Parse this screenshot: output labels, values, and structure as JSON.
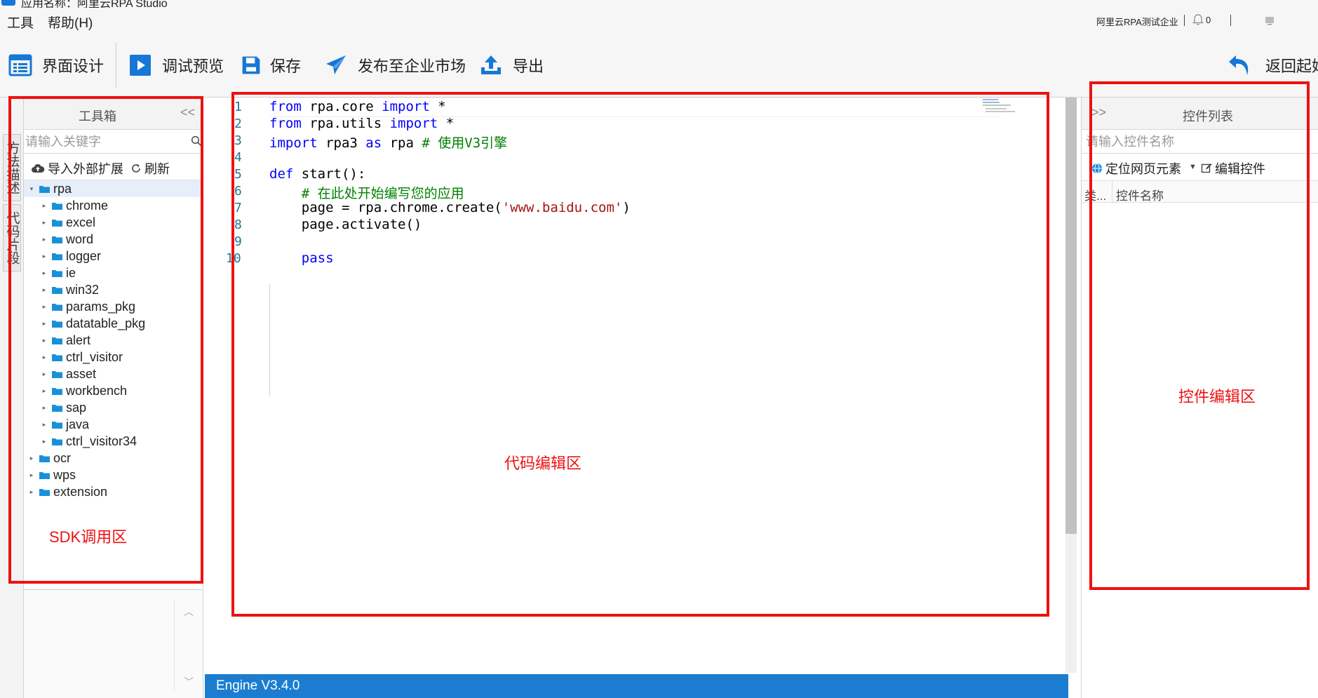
{
  "window": {
    "title": "应用名称：阿里云RPA Studio"
  },
  "menu": {
    "tools": "工具",
    "help": "帮助(H)"
  },
  "topbar": {
    "org_name": "阿里云RPA测试企业",
    "notification_count": "0"
  },
  "toolbar": {
    "ui_design": "界面设计",
    "debug_preview": "调试预览",
    "save": "保存",
    "publish": "发布至企业市场",
    "export": "导出",
    "back": "返回起始"
  },
  "side_tabs": {
    "method_desc": "方法描述",
    "code_snippet": "代码片段"
  },
  "toolbox": {
    "title": "工具箱",
    "collapse": "<<",
    "search_placeholder": "请输入关键字",
    "import_ext": "导入外部扩展",
    "refresh": "刷新",
    "tree": [
      {
        "label": "rpa",
        "level": 0,
        "expanded": true,
        "selected": true
      },
      {
        "label": "chrome",
        "level": 1
      },
      {
        "label": "excel",
        "level": 1
      },
      {
        "label": "word",
        "level": 1
      },
      {
        "label": "logger",
        "level": 1
      },
      {
        "label": "ie",
        "level": 1
      },
      {
        "label": "win32",
        "level": 1
      },
      {
        "label": "params_pkg",
        "level": 1
      },
      {
        "label": "datatable_pkg",
        "level": 1
      },
      {
        "label": "alert",
        "level": 1
      },
      {
        "label": "ctrl_visitor",
        "level": 1
      },
      {
        "label": "asset",
        "level": 1
      },
      {
        "label": "workbench",
        "level": 1
      },
      {
        "label": "sap",
        "level": 1
      },
      {
        "label": "java",
        "level": 1
      },
      {
        "label": "ctrl_visitor34",
        "level": 1
      },
      {
        "label": "ocr",
        "level": 0
      },
      {
        "label": "wps",
        "level": 0
      },
      {
        "label": "extension",
        "level": 0
      }
    ]
  },
  "editor": {
    "line_numbers": [
      "1",
      "2",
      "3",
      "4",
      "5",
      "6",
      "7",
      "8",
      "9",
      "10"
    ],
    "code_lines": [
      [
        {
          "t": "kw",
          "v": "from"
        },
        {
          "t": "p",
          "v": " rpa.core "
        },
        {
          "t": "kw",
          "v": "import"
        },
        {
          "t": "p",
          "v": " *"
        }
      ],
      [
        {
          "t": "kw",
          "v": "from"
        },
        {
          "t": "p",
          "v": " rpa.utils "
        },
        {
          "t": "kw",
          "v": "import"
        },
        {
          "t": "p",
          "v": " *"
        }
      ],
      [
        {
          "t": "kw",
          "v": "import"
        },
        {
          "t": "p",
          "v": " rpa3 "
        },
        {
          "t": "kw",
          "v": "as"
        },
        {
          "t": "p",
          "v": " rpa "
        },
        {
          "t": "cmt",
          "v": "# 使用V3引擎"
        }
      ],
      [],
      [
        {
          "t": "kw",
          "v": "def"
        },
        {
          "t": "p",
          "v": " start():"
        }
      ],
      [
        {
          "t": "p",
          "v": "    "
        },
        {
          "t": "cmt",
          "v": "# 在此处开始编写您的应用"
        }
      ],
      [
        {
          "t": "p",
          "v": "    page = rpa.chrome.create("
        },
        {
          "t": "str",
          "v": "'www.baidu.com'"
        },
        {
          "t": "p",
          "v": ")"
        }
      ],
      [
        {
          "t": "p",
          "v": "    page.activate()"
        }
      ],
      [],
      [
        {
          "t": "p",
          "v": "    "
        },
        {
          "t": "kw",
          "v": "pass"
        }
      ]
    ],
    "status": "Engine V3.4.0"
  },
  "controls_panel": {
    "expand": ">>",
    "title": "控件列表",
    "search_placeholder": "请输入控件名称",
    "locate": "定位网页元素",
    "edit": "编辑控件",
    "col_type": "类...",
    "col_name": "控件名称"
  },
  "annotations": {
    "sdk": "SDK调用区",
    "code": "代码编辑区",
    "controls": "控件编辑区",
    "color": "#ee1111"
  },
  "colors": {
    "accent": "#1677d6",
    "statusbar": "#1c7dd0",
    "keyword": "#0000ff",
    "string": "#a31515",
    "comment": "#008000"
  }
}
